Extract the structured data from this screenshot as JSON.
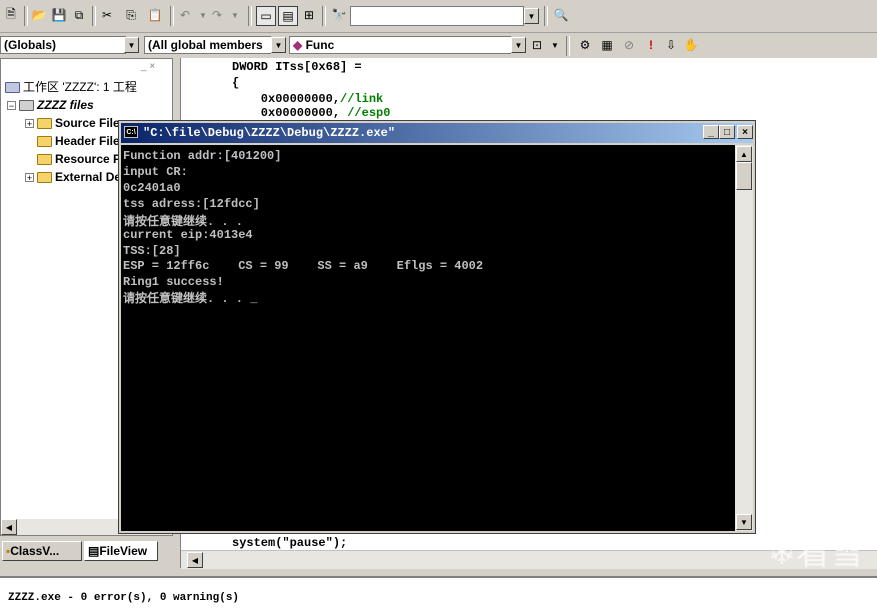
{
  "toolbar2": {
    "globals_combo": "(Globals)",
    "members_combo": "(All global members",
    "func_combo": "Func"
  },
  "workspace": {
    "title": "工作区 'ZZZZ': 1 工程",
    "project": "ZZZZ files",
    "items": [
      {
        "label": "Source Files",
        "expander": "+"
      },
      {
        "label": "Header Files",
        "expander": ""
      },
      {
        "label": "Resource Files",
        "expander": ""
      },
      {
        "label": "External Dependencies",
        "expander": "+"
      }
    ]
  },
  "editor": {
    "lines": [
      {
        "code": "DWORD ITss[0x68] =",
        "comment": ""
      },
      {
        "code": "{",
        "comment": ""
      },
      {
        "code": "    0x00000000,",
        "comment": "//link"
      },
      {
        "code": "    0x00000000, ",
        "comment": "//esp0"
      }
    ],
    "bottom_line": "system(\"pause\");"
  },
  "tabs": {
    "classview": "ClassV...",
    "fileview": "FileView"
  },
  "console": {
    "title": "\"C:\\file\\Debug\\ZZZZ\\Debug\\ZZZZ.exe\"",
    "lines": [
      "Function addr:[401200]",
      "input CR:",
      "0c2401a0",
      "tss adress:[12fdcc]",
      "请按任意键继续. . .",
      "current eip:4013e4",
      "TSS:[28]",
      "ESP = 12ff6c    CS = 99    SS = a9    Eflgs = 4002",
      "Ring1 success!",
      "请按任意键继续. . . _"
    ]
  },
  "output": {
    "message": "ZZZZ.exe - 0 error(s), 0 warning(s)"
  },
  "watermark": "看雪"
}
